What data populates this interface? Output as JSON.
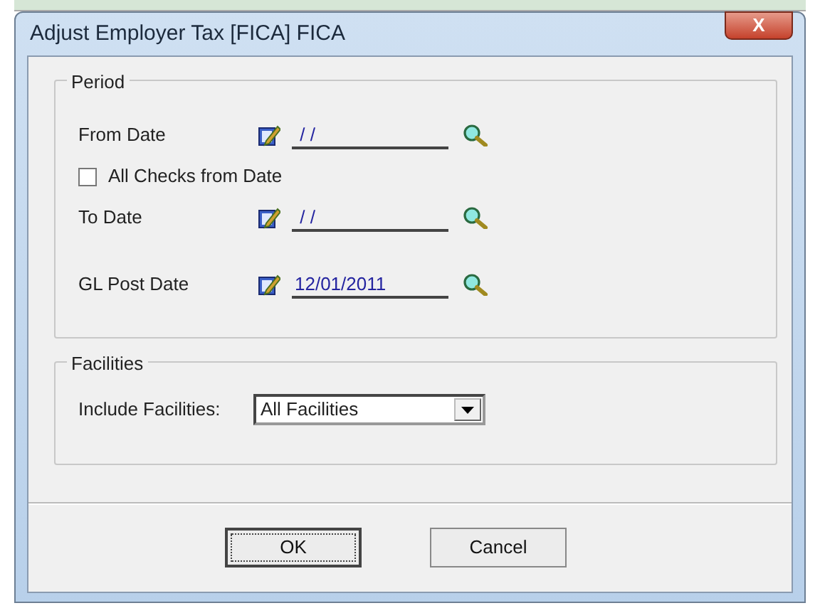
{
  "window": {
    "title": "Adjust Employer Tax [FICA] FICA",
    "close_label": "X"
  },
  "period": {
    "legend": "Period",
    "rows": [
      {
        "kind": "date",
        "label": "From Date",
        "value": " / /"
      },
      {
        "kind": "checkbox",
        "label": "All Checks from Date",
        "checked": false
      },
      {
        "kind": "date",
        "label": "To Date",
        "value": " / /"
      },
      {
        "kind": "date",
        "label": "GL Post Date",
        "value": "12/01/2011"
      }
    ]
  },
  "facilities": {
    "legend": "Facilities",
    "label": "Include Facilities:",
    "value": "All Facilities"
  },
  "buttons": [
    {
      "label": "OK",
      "default": true
    },
    {
      "label": "Cancel",
      "default": false
    }
  ]
}
